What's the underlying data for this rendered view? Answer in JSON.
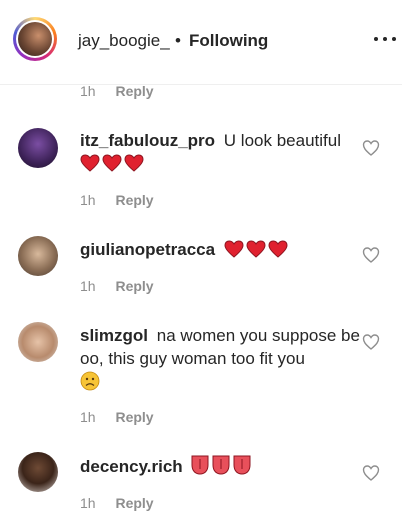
{
  "header": {
    "username": "jay_boogie_",
    "separator": "•",
    "follow_status": "Following"
  },
  "top_meta": {
    "time": "1h",
    "reply": "Reply"
  },
  "comments": [
    {
      "username": "itz_fabulouz_pro",
      "text": "U look beautiful",
      "emoji": "red-heart x3",
      "time": "1h",
      "reply": "Reply"
    },
    {
      "username": "giulianopetracca",
      "text": "",
      "emoji": "red-heart x3",
      "time": "1h",
      "reply": "Reply"
    },
    {
      "username": "slimzgol",
      "text": "na women you suppose be oo, this guy woman too fit you",
      "emoji": "sad-face",
      "time": "1h",
      "reply": "Reply"
    },
    {
      "username": "decency.rich",
      "text": "",
      "emoji": "tongue x3",
      "time": "1h",
      "reply": "Reply"
    }
  ],
  "colors": {
    "text": "#262626",
    "secondary": "#8e8e8e",
    "heart_emoji": "#e0212f",
    "divider": "#efefef"
  },
  "icons": [
    "more-icon",
    "like-heart-icon",
    "red-heart-emoji",
    "sad-face-emoji",
    "tongue-emoji"
  ]
}
